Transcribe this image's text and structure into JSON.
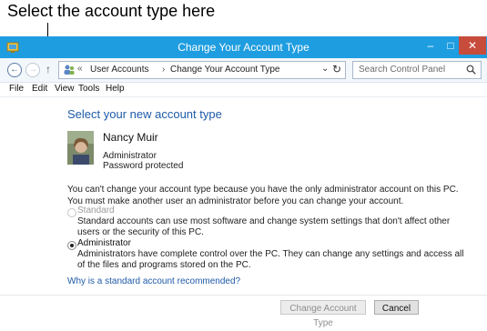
{
  "annotation": {
    "text": "Select the account type here"
  },
  "window": {
    "title": "Change Your Account Type",
    "controls": {
      "minimize": "–",
      "maximize": "□",
      "close": "✕"
    }
  },
  "address": {
    "prefix": "«",
    "breadcrumbs": [
      "User Accounts",
      "Change Your Account Type"
    ],
    "separator": "›",
    "dropdown": "⌄",
    "refresh": "↻"
  },
  "search": {
    "placeholder": "Search Control Panel"
  },
  "menu": [
    "File",
    "Edit",
    "View",
    "Tools",
    "Help"
  ],
  "content": {
    "heading": "Select your new account type",
    "user": {
      "name": "Nancy Muir",
      "role": "Administrator",
      "password_status": "Password protected"
    },
    "info": "You can't change your account type because you have the only administrator account on this PC. You must make another user an administrator before you can change your account.",
    "options": [
      {
        "label": "Standard",
        "selected": false,
        "enabled": false,
        "description": "Standard accounts can use most software and change system settings that don't affect other users or the security of this PC."
      },
      {
        "label": "Administrator",
        "selected": true,
        "enabled": true,
        "description": "Administrators have complete control over the PC. They can change any settings and access all of the files and programs stored on the PC."
      }
    ],
    "link": "Why is a standard account recommended?"
  },
  "buttons": {
    "change": "Change Account Type",
    "cancel": "Cancel"
  },
  "colors": {
    "titlebar": "#1e9de0",
    "close": "#c74c3c",
    "heading": "#1e5aa8",
    "link": "#1e5aa8"
  }
}
